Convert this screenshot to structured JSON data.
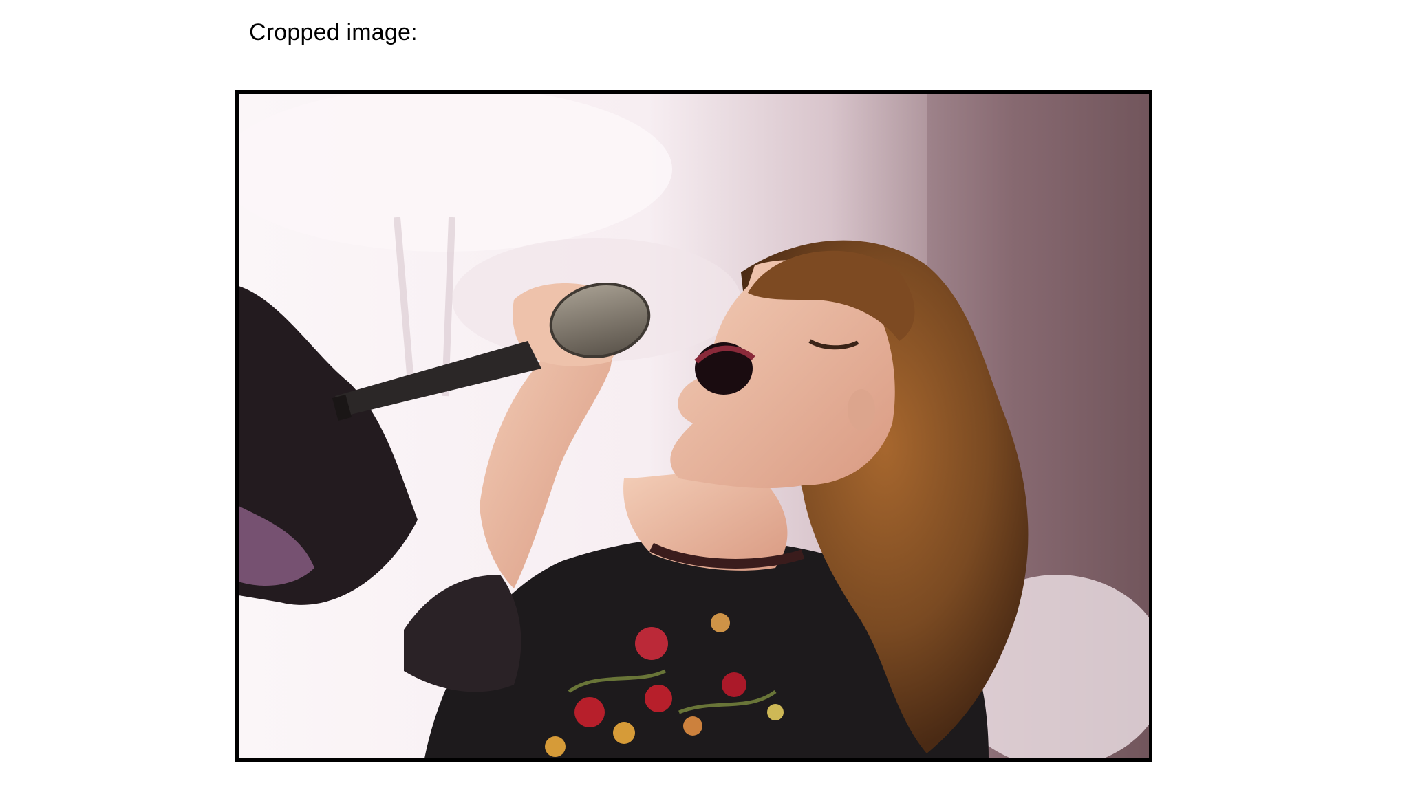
{
  "slide": {
    "caption": "Cropped image:"
  },
  "image": {
    "subject": "singer-with-microphone",
    "colors": {
      "background_light": "#f6eef1",
      "background_mauve": "#8e7178",
      "hair": "#7a4a22",
      "skin": "#e9b8a0",
      "outfit": "#1d1a1c",
      "floral_red": "#c0202c",
      "microphone_grille": "#8b8275"
    }
  }
}
